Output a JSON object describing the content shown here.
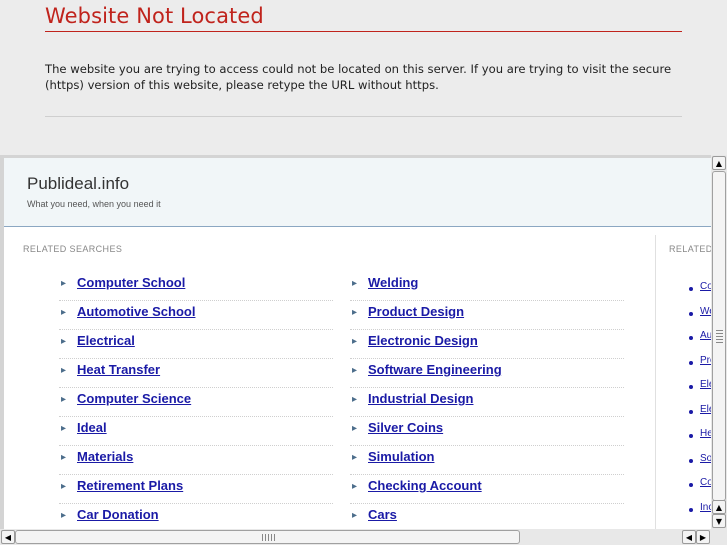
{
  "error": {
    "title": "Website Not Located",
    "message": "The website you are trying to access could not be located on this server. If you are trying to visit the secure (https) version of this website, please retype the URL without https."
  },
  "site": {
    "title": "Publideal.info",
    "tagline": "What you need, when you need it",
    "related_label": "RELATED SEARCHES",
    "side_label": "RELATED",
    "left_links": [
      "Computer School",
      "Automotive School",
      "Electrical",
      "Heat Transfer",
      "Computer Science",
      "Ideal",
      "Materials",
      "Retirement Plans",
      "Car Donation"
    ],
    "right_links": [
      "Welding",
      "Product Design",
      "Electronic Design",
      "Software Engineering",
      "Industrial Design",
      "Silver Coins",
      "Simulation",
      "Checking Account",
      "Cars"
    ],
    "side_links": [
      "Co",
      "We",
      "Aut",
      "Pro",
      "Ele",
      "Ele",
      "He",
      "So",
      "Co",
      "Inc"
    ]
  },
  "icons": {
    "arrow": "▸",
    "scroll_up": "▲",
    "scroll_down": "▼",
    "scroll_left": "◀",
    "scroll_right": "▶"
  },
  "colors": {
    "error_red": "#c0231c",
    "link_blue": "#1a1aa6",
    "header_border": "#8ba7c2"
  }
}
